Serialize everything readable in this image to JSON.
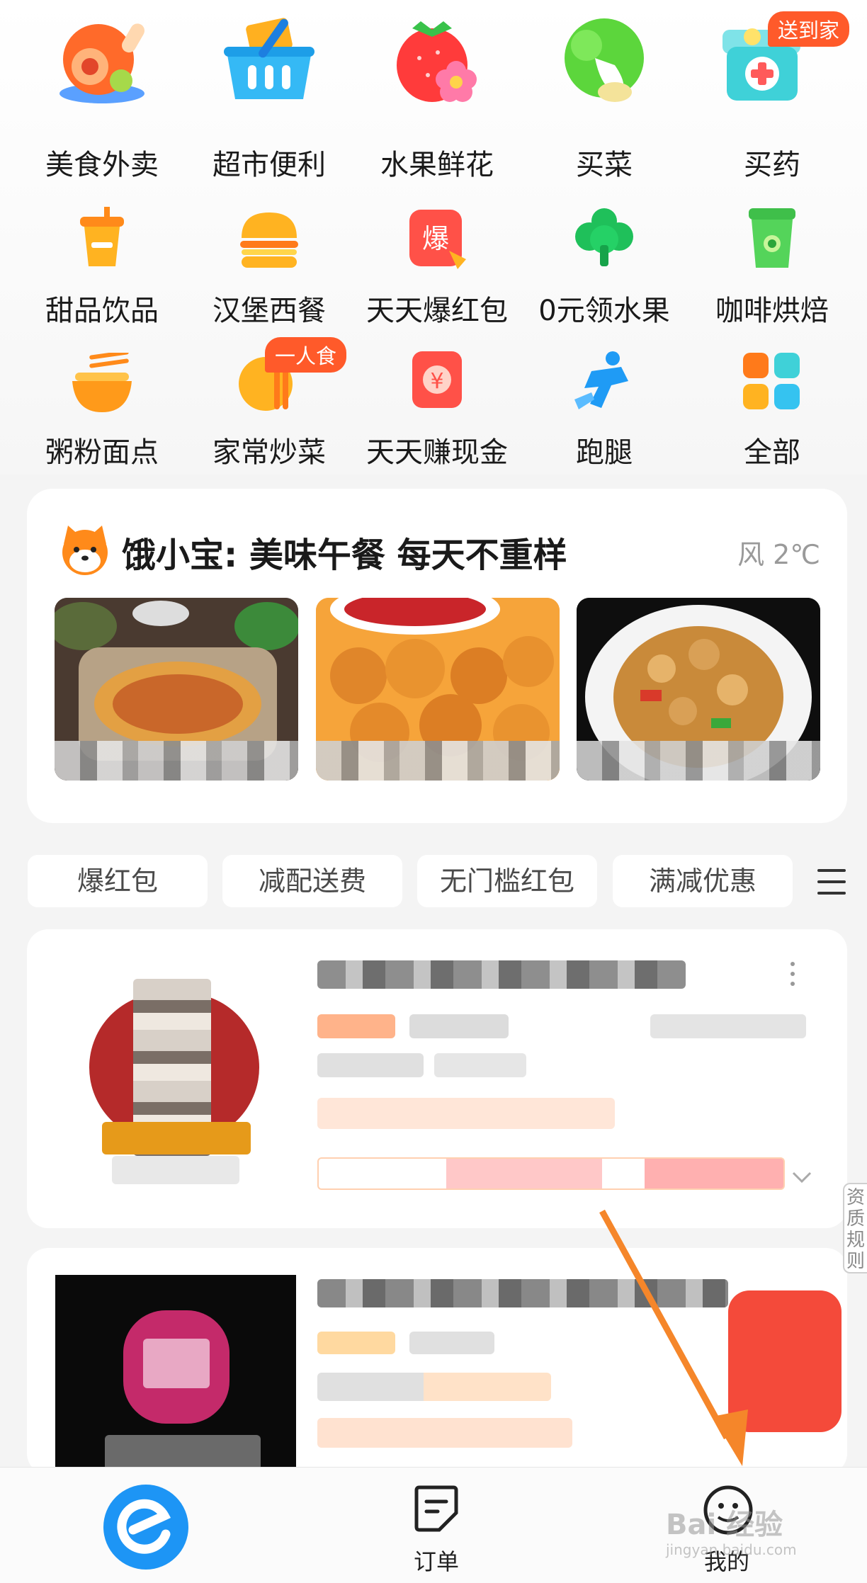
{
  "categories": [
    {
      "label": "美食外卖",
      "icon": "food-delivery-icon"
    },
    {
      "label": "超市便利",
      "icon": "supermarket-basket-icon"
    },
    {
      "label": "水果鲜花",
      "icon": "strawberry-flower-icon"
    },
    {
      "label": "买菜",
      "icon": "vegetable-icon"
    },
    {
      "label": "买药",
      "icon": "medicine-box-icon",
      "badge": "送到家"
    },
    {
      "label": "甜品饮品",
      "icon": "drink-cup-icon"
    },
    {
      "label": "汉堡西餐",
      "icon": "burger-icon"
    },
    {
      "label": "天天爆红包",
      "icon": "red-packet-icon",
      "icon_text": "爆"
    },
    {
      "label": "0元领水果",
      "icon": "tree-icon"
    },
    {
      "label": "咖啡烘焙",
      "icon": "coffee-cup-icon"
    },
    {
      "label": "粥粉面点",
      "icon": "noodle-bowl-icon"
    },
    {
      "label": "家常炒菜",
      "icon": "home-dish-icon",
      "badge": "一人食"
    },
    {
      "label": "天天赚现金",
      "icon": "cash-envelope-icon",
      "icon_text": "¥"
    },
    {
      "label": "跑腿",
      "icon": "runner-icon"
    },
    {
      "label": "全部",
      "icon": "all-grid-icon"
    }
  ],
  "promo": {
    "title": "饿小宝: 美味午餐 每天不重样",
    "weather": "风 2℃",
    "dishes": [
      "noodles-image",
      "fried-chicken-image",
      "stir-fry-image"
    ]
  },
  "filters": [
    "爆红包",
    "减配送费",
    "无门槛红包",
    "满减优惠"
  ],
  "nav": {
    "orders_label": "订单",
    "mine_label": "我的"
  },
  "side_tab": "资质规则",
  "watermark": {
    "main": "Bai 经验",
    "sub": "jingyan.baidu.com"
  },
  "colors": {
    "brand_blue": "#1890ff",
    "accent_orange": "#ff5a2a",
    "arrow": "#f5862a"
  }
}
